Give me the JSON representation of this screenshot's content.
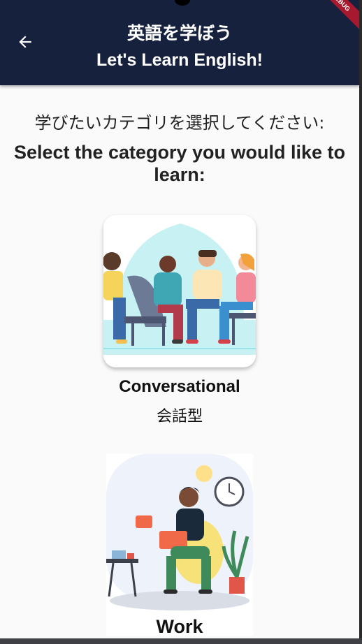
{
  "appbar": {
    "title_jp": "英語を学ぼう",
    "title_en": "Let's Learn English!",
    "back_icon": "arrow-left-icon",
    "debug_badge": "DEBUG"
  },
  "prompt": {
    "jp": "学びたいカテゴリを選択してください:",
    "en": "Select the category you would like to learn:"
  },
  "categories": [
    {
      "label_en": "Conversational",
      "label_jp": "会話型",
      "icon": "people-conversation-illustration"
    },
    {
      "label_en": "Work",
      "icon": "person-working-laptop-illustration"
    }
  ],
  "colors": {
    "appbar": "#16213d",
    "background": "#fafafa",
    "debug_ribbon": "#a6192e"
  }
}
